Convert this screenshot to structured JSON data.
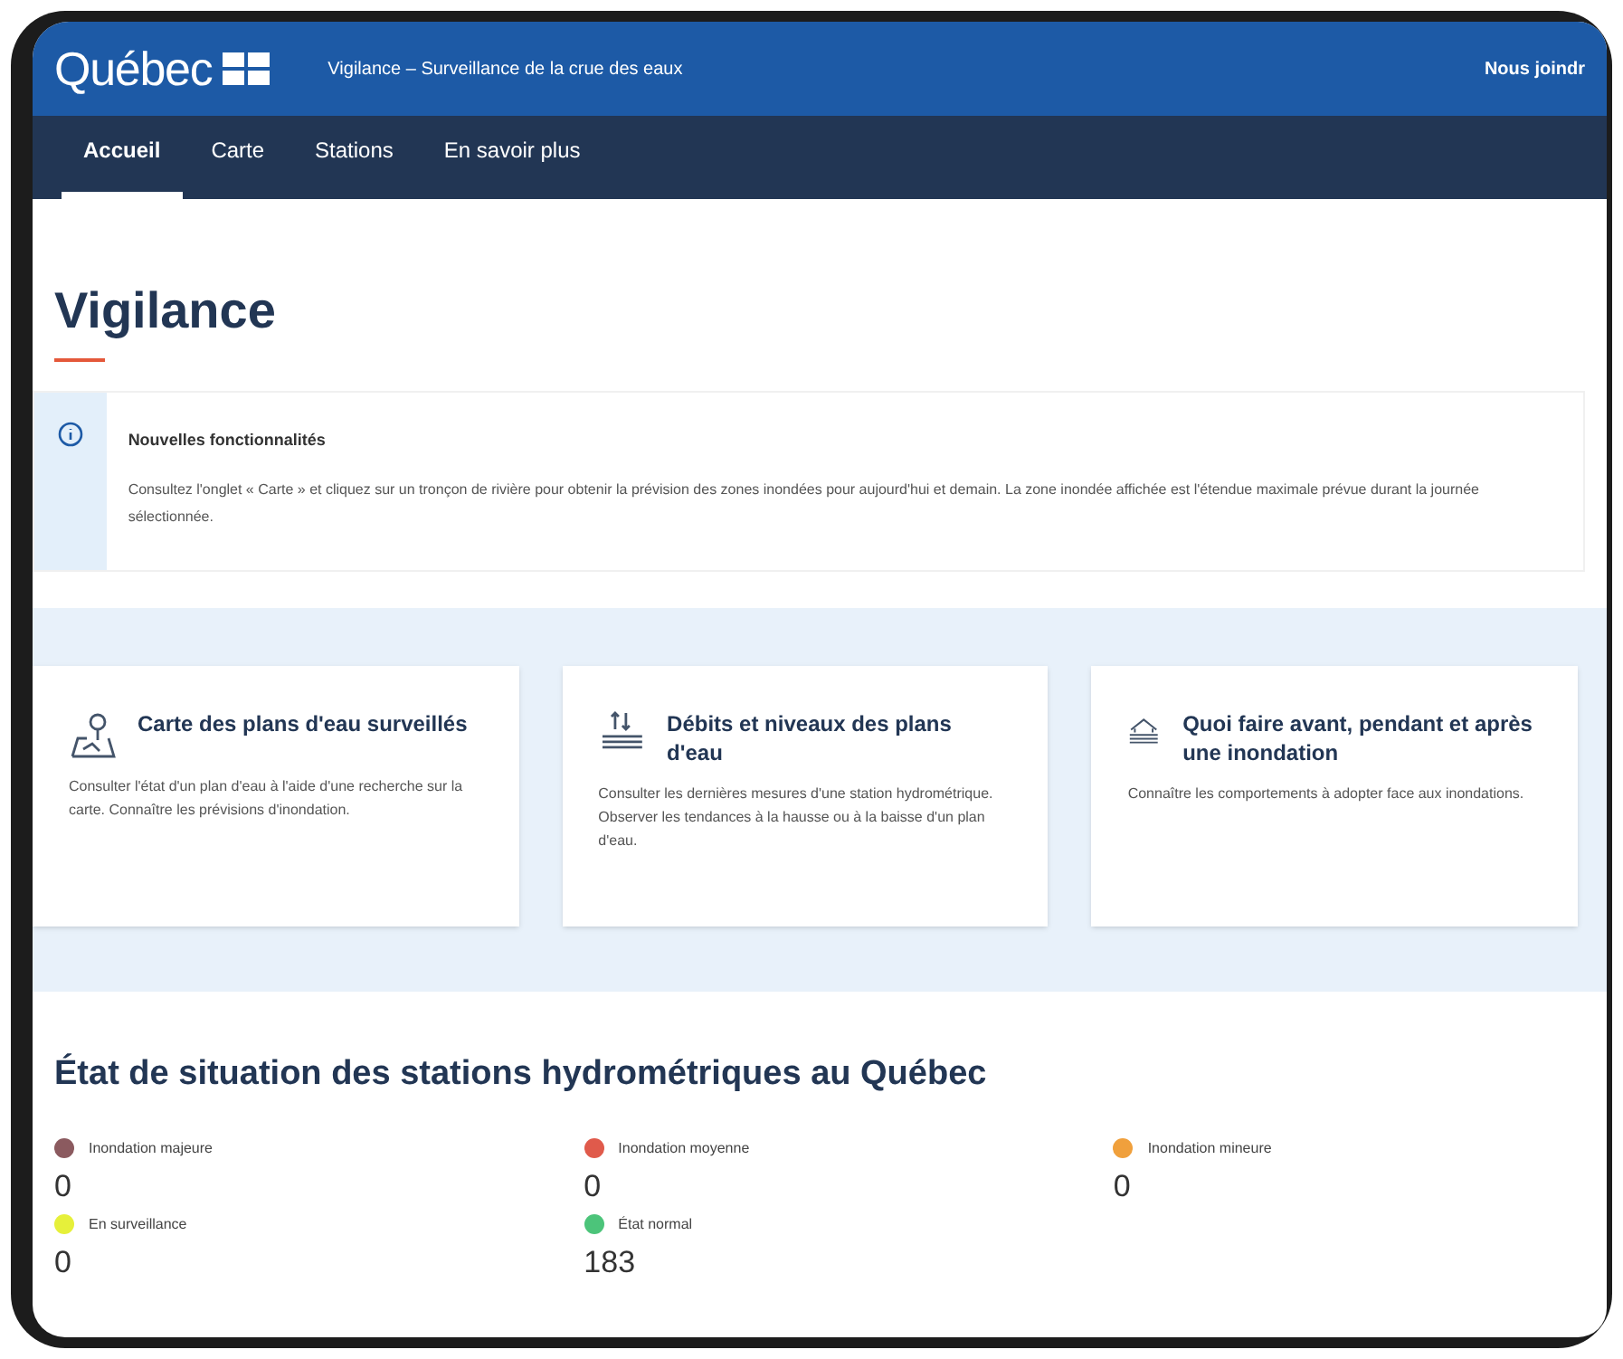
{
  "header": {
    "logo": "Québec",
    "site_title": "Vigilance – Surveillance de la crue des eaux",
    "contact_link": "Nous joindr"
  },
  "nav": [
    {
      "label": "Accueil",
      "selected": true
    },
    {
      "label": "Carte",
      "selected": false
    },
    {
      "label": "Stations",
      "selected": false
    },
    {
      "label": "En savoir plus",
      "selected": false
    }
  ],
  "page_title": "Vigilance",
  "notice": {
    "title": "Nouvelles fonctionnalités",
    "text": "Consultez l'onglet « Carte » et cliquez sur un tronçon de rivière pour obtenir la prévision des zones inondées pour aujourd'hui et demain. La zone inondée affichée est l'étendue maximale prévue durant la journée sélectionnée."
  },
  "cards": [
    {
      "kind": "map",
      "title": "Carte des plans d'eau surveillés",
      "text": "Consulter l'état d'un plan d'eau à l'aide d'une recherche sur la carte. Connaître les prévisions d'inondation."
    },
    {
      "kind": "levels",
      "title": "Débits et niveaux des plans d'eau",
      "text": "Consulter les dernières mesures d'une station hydrométrique. Observer les tendances à la hausse ou à la baisse d'un plan d'eau."
    },
    {
      "kind": "flood",
      "title": "Quoi faire avant, pendant et après une inondation",
      "text": "Connaître les comportements à adopter face aux inondations."
    }
  ],
  "stations_heading": "État de situation des stations hydrométriques au Québec",
  "statuses": [
    {
      "label": "Inondation majeure",
      "color": "#8b5a5f",
      "count": "0"
    },
    {
      "label": "Inondation moyenne",
      "color": "#e05a4b",
      "count": "0"
    },
    {
      "label": "Inondation mineure",
      "color": "#f0a03c",
      "count": "0"
    },
    {
      "label": "En surveillance",
      "color": "#e6f03a",
      "count": "0"
    },
    {
      "label": "État normal",
      "color": "#4cc47a",
      "count": "183"
    }
  ]
}
